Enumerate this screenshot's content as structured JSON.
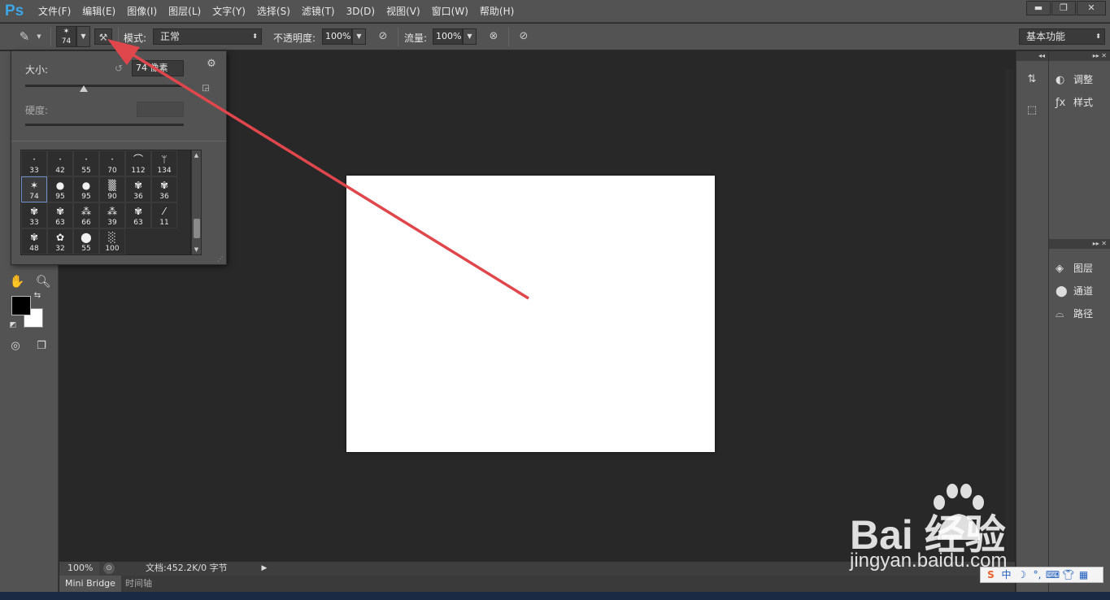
{
  "app": {
    "logo": "Ps"
  },
  "menu": [
    "文件(F)",
    "编辑(E)",
    "图像(I)",
    "图层(L)",
    "文字(Y)",
    "选择(S)",
    "滤镜(T)",
    "3D(D)",
    "视图(V)",
    "窗口(W)",
    "帮助(H)"
  ],
  "window_controls": {
    "minimize": "▬",
    "restore": "❐",
    "close": "✕"
  },
  "options": {
    "brush_size": "74",
    "mode_label": "模式:",
    "mode_value": "正常",
    "opacity_label": "不透明度:",
    "opacity_value": "100%",
    "flow_label": "流量:",
    "flow_value": "100%",
    "workspace": "基本功能"
  },
  "brush_popup": {
    "size_label": "大小:",
    "size_value": "74 像素",
    "size_fraction": 0.37,
    "hardness_label": "硬度:",
    "presets": [
      {
        "num": "33",
        "glyph": "·"
      },
      {
        "num": "42",
        "glyph": "·"
      },
      {
        "num": "55",
        "glyph": "·"
      },
      {
        "num": "70",
        "glyph": "·"
      },
      {
        "num": "112",
        "glyph": "⌒"
      },
      {
        "num": "134",
        "glyph": "ᛘ"
      },
      {
        "num": "74",
        "glyph": "✶",
        "selected": true
      },
      {
        "num": "95",
        "glyph": "●"
      },
      {
        "num": "95",
        "glyph": "●"
      },
      {
        "num": "90",
        "glyph": "▒"
      },
      {
        "num": "36",
        "glyph": "✾"
      },
      {
        "num": "36",
        "glyph": "✾"
      },
      {
        "num": "33",
        "glyph": "✾"
      },
      {
        "num": "63",
        "glyph": "✾"
      },
      {
        "num": "66",
        "glyph": "⁂"
      },
      {
        "num": "39",
        "glyph": "⁂"
      },
      {
        "num": "63",
        "glyph": "✾"
      },
      {
        "num": "11",
        "glyph": "⁄"
      },
      {
        "num": "48",
        "glyph": "✾"
      },
      {
        "num": "32",
        "glyph": "✿"
      },
      {
        "num": "55",
        "glyph": "⬤"
      },
      {
        "num": "100",
        "glyph": "░"
      }
    ]
  },
  "status": {
    "zoom": "100%",
    "doc": "文档:452.2K/0 字节"
  },
  "bottom_tabs": [
    "Mini Bridge",
    "时间轴"
  ],
  "dock": {
    "group1": [
      {
        "label": "调整",
        "icon": "adjustments-icon"
      },
      {
        "label": "样式",
        "icon": "styles-icon"
      }
    ],
    "group2": [
      {
        "label": "图层",
        "icon": "layers-icon"
      },
      {
        "label": "通道",
        "icon": "channels-icon"
      },
      {
        "label": "路径",
        "icon": "paths-icon"
      }
    ]
  },
  "watermark": {
    "brand": "Bai  经验",
    "sub": "jingyan.baidu.com"
  },
  "colors": {
    "annotation": "#e0474c",
    "ps_blue": "#3da6e6"
  }
}
